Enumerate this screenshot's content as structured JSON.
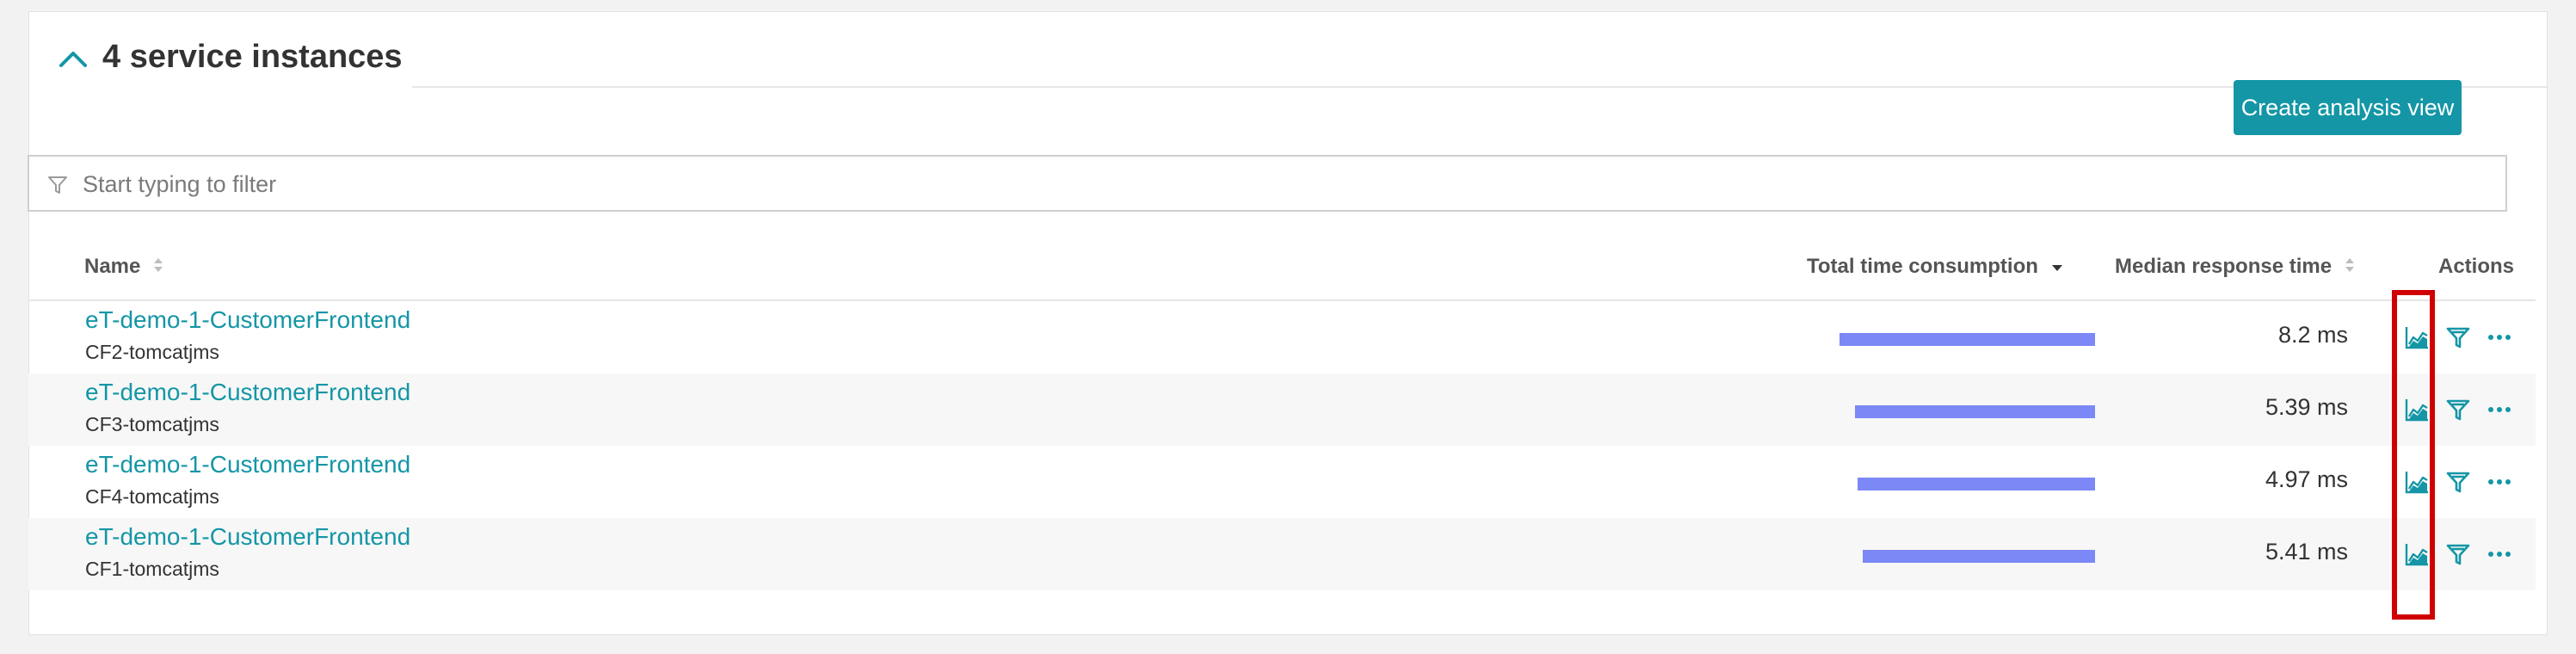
{
  "section": {
    "title": "4 service instances",
    "collapse_icon": "chevron-up-icon"
  },
  "toolbar": {
    "create_label": "Create analysis view"
  },
  "filter": {
    "placeholder": "Start typing to filter",
    "value": "",
    "icon": "funnel-icon"
  },
  "table": {
    "columns": {
      "name": "Name",
      "total_time": "Total time consumption",
      "median": "Median response time",
      "actions": "Actions"
    },
    "sorted_by": "total_time",
    "sort_direction": "desc",
    "rows": [
      {
        "name": "eT-demo-1-CustomerFrontend",
        "instance": "CF2-tomcatjms",
        "total_time_fraction": 1.0,
        "median": "8.2 ms"
      },
      {
        "name": "eT-demo-1-CustomerFrontend",
        "instance": "CF3-tomcatjms",
        "total_time_fraction": 0.94,
        "median": "5.39 ms"
      },
      {
        "name": "eT-demo-1-CustomerFrontend",
        "instance": "CF4-tomcatjms",
        "total_time_fraction": 0.93,
        "median": "4.97 ms"
      },
      {
        "name": "eT-demo-1-CustomerFrontend",
        "instance": "CF1-tomcatjms",
        "total_time_fraction": 0.91,
        "median": "5.41 ms"
      }
    ],
    "row_actions": [
      "chart-icon",
      "filter-icon",
      "more-icon"
    ]
  },
  "colors": {
    "accent": "#1496a6",
    "bar": "#7b88f5",
    "highlight": "#d10000",
    "row_alt": "#f7f7f7"
  }
}
